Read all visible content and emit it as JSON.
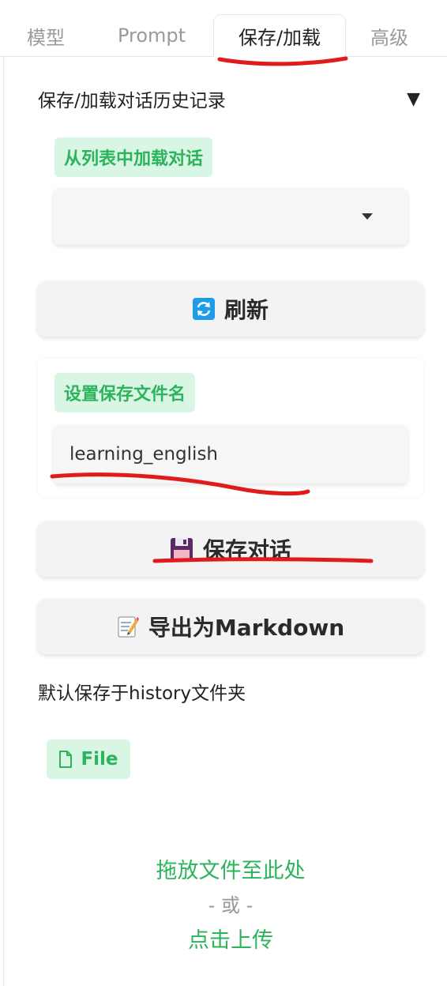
{
  "tabs": [
    {
      "label": "模型",
      "active": false
    },
    {
      "label": "Prompt",
      "active": false
    },
    {
      "label": "保存/加载",
      "active": true
    },
    {
      "label": "高级",
      "active": false
    }
  ],
  "accordion": {
    "title": "保存/加载对话历史记录",
    "toggle_glyph": "▼"
  },
  "load_section": {
    "label": "从列表中加载对话",
    "selected_value": ""
  },
  "refresh_button": {
    "label": "刷新"
  },
  "filename_section": {
    "label": "设置保存文件名",
    "value": "learning_english"
  },
  "save_button": {
    "label": "保存对话"
  },
  "export_button": {
    "label": "导出为Markdown"
  },
  "note": "默认保存于history文件夹",
  "file_upload": {
    "chip_label": "File",
    "drop_text": "拖放文件至此处",
    "or_text": "- 或 -",
    "click_text": "点击上传"
  },
  "colors": {
    "accent_green": "#2bb45c",
    "chip_bg": "#d9f5e3",
    "annotation_red": "#e01b1b"
  },
  "icons": {
    "refresh": "refresh-icon",
    "save": "floppy-disk-icon",
    "export": "memo-icon",
    "file": "file-icon",
    "dropdown": "caret-down-icon"
  }
}
